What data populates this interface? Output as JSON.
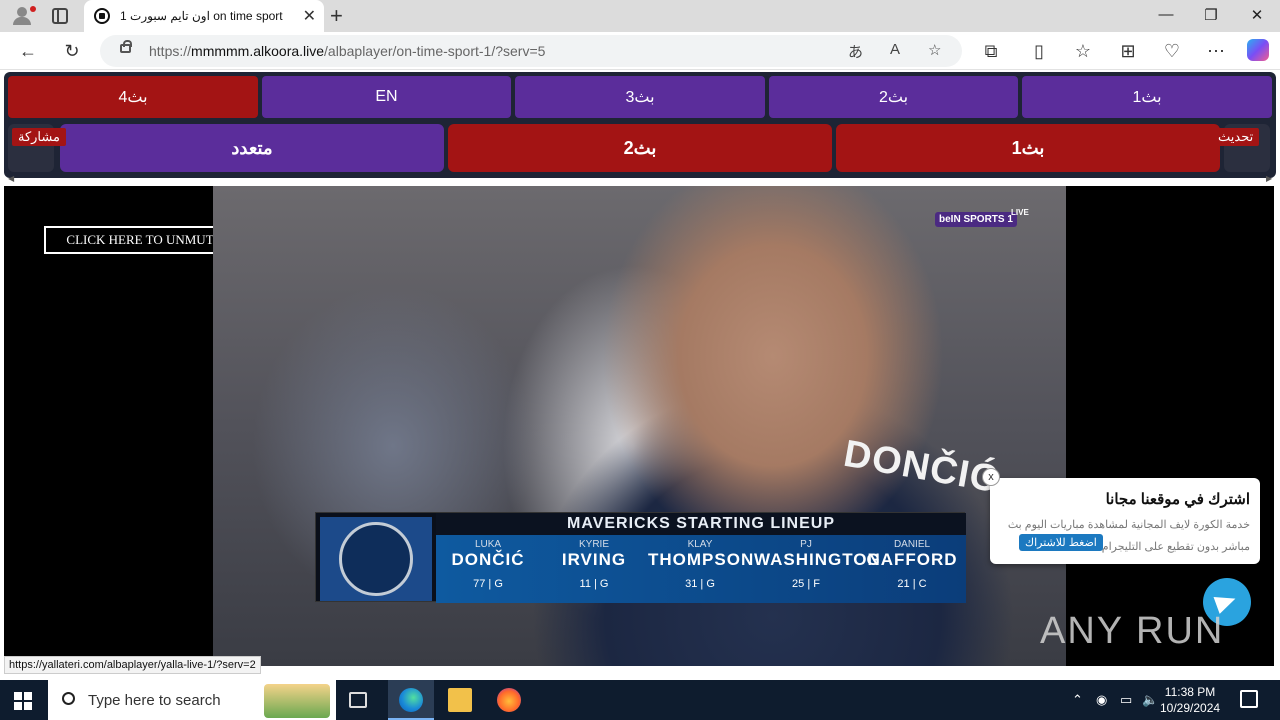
{
  "browser": {
    "tab_title": "اون تايم سبورت 1 on time sport",
    "tab_close": "✕",
    "new_tab": "+",
    "url_prefix": "https://",
    "url_host": "mmmmm.alkoora.live",
    "url_path": "/albaplayer/on-time-sport-1/?serv=5",
    "window_controls": [
      "—",
      "❐",
      "✕"
    ],
    "icons": [
      "back-arrow-icon",
      "refresh-icon",
      "lock-icon",
      "translate-icon",
      "read-aloud-icon",
      "favorite-star-icon",
      "extensions-icon",
      "split-screen-icon",
      "favorites-icon",
      "collections-icon",
      "performance-icon",
      "more-icon",
      "copilot-icon"
    ]
  },
  "servers": {
    "row1": [
      "بث4",
      "EN",
      "بث3",
      "بث2",
      "بث1"
    ],
    "row2": [
      "متعدد",
      "بث2",
      "بث1"
    ],
    "share_label": "مشاركة",
    "refresh_label": "تحديث"
  },
  "player": {
    "unmute_label": "CLICK HERE TO UNMUTE",
    "channel_logo": "beIN SPORTS 1",
    "live_label": "LIVE",
    "jersey_name": "DONČIĆ",
    "lineup_title": "MAVERICKS STARTING LINEUP",
    "players": [
      {
        "first": "LUKA",
        "last": "DONČIĆ",
        "number": "77 | G"
      },
      {
        "first": "KYRIE",
        "last": "IRVING",
        "number": "11 | G"
      },
      {
        "first": "KLAY",
        "last": "THOMPSON",
        "number": "31 | G"
      },
      {
        "first": "PJ",
        "last": "WASHINGTON",
        "number": "25 | F"
      },
      {
        "first": "DANIEL",
        "last": "GAFFORD",
        "number": "21 | C"
      }
    ]
  },
  "popup": {
    "close": "x",
    "title": "اشترك في موقعنا مجانا",
    "body": "خدمة الكورة لايف المجانية لمشاهدة مباريات اليوم بث مباشر بدون تقطيع على التليجرام",
    "subscribe": "اضغط للاشتراك"
  },
  "watermark": "ANY RUN",
  "status_url": "https://yallateri.com/albaplayer/yalla-live-1/?serv=2",
  "taskbar": {
    "search_placeholder": "Type here to search",
    "time": "11:38 PM",
    "date": "10/29/2024"
  },
  "colors": {
    "server_red": "#a31414",
    "server_purple": "#5b2d9b",
    "telegram": "#2aa3df"
  }
}
